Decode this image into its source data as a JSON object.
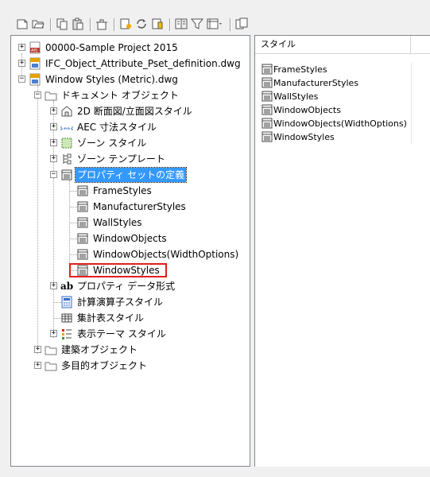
{
  "toolbar": {
    "buttons": [
      {
        "icon": "new-icon"
      },
      {
        "icon": "open-folder-icon"
      },
      {
        "icon": "copy-icon"
      },
      {
        "icon": "paste-icon"
      },
      {
        "icon": "purge-icon"
      },
      {
        "icon": "new-style-icon"
      },
      {
        "icon": "synchronize-icon"
      },
      {
        "icon": "edit-standards-icon"
      },
      {
        "icon": "toggle-view-icon"
      },
      {
        "icon": "filter-icon"
      },
      {
        "icon": "view-mode-icon"
      },
      {
        "icon": "inventory-icon"
      }
    ]
  },
  "tree": {
    "items": [
      {
        "label": "00000-Sample Project 2015",
        "icon": "project-icon",
        "expander": "+"
      },
      {
        "label": "IFC_Object_Attribute_Pset_definition.dwg",
        "icon": "drawing-icon",
        "expander": "+"
      },
      {
        "label": "Window Styles (Metric).dwg",
        "icon": "drawing-icon",
        "expander": "−"
      },
      {
        "label": "ドキュメント オブジェクト",
        "icon": "folder-icon",
        "expander": "−"
      },
      {
        "label": "2D 断面図/立面図スタイル",
        "icon": "section-elevation-icon",
        "expander": "+"
      },
      {
        "label": "AEC 寸法スタイル",
        "icon": "dimension-icon",
        "expander": "+"
      },
      {
        "label": "ゾーン スタイル",
        "icon": "zone-icon",
        "expander": "+"
      },
      {
        "label": "ゾーン テンプレート",
        "icon": "zone-template-icon",
        "expander": "+"
      },
      {
        "label": "プロパティ セットの定義",
        "icon": "property-set-icon",
        "expander": "−"
      },
      {
        "label": "FrameStyles",
        "icon": "property-set-icon"
      },
      {
        "label": "ManufacturerStyles",
        "icon": "property-set-icon"
      },
      {
        "label": "WallStyles",
        "icon": "property-set-icon"
      },
      {
        "label": "WindowObjects",
        "icon": "property-set-icon"
      },
      {
        "label": "WindowObjects(WidthOptions)",
        "icon": "property-set-icon"
      },
      {
        "label": "WindowStyles",
        "icon": "property-set-icon"
      },
      {
        "label": "プロパティ データ形式",
        "icon": "data-format-icon",
        "icon_text": "ab",
        "expander": "+"
      },
      {
        "label": "計算演算子スタイル",
        "icon": "calculation-icon"
      },
      {
        "label": "集計表スタイル",
        "icon": "schedule-table-icon"
      },
      {
        "label": "表示テーマ スタイル",
        "icon": "display-theme-icon",
        "expander": "+"
      },
      {
        "label": "建築オブジェクト",
        "icon": "folder-icon",
        "expander": "+"
      },
      {
        "label": "多目的オブジェクト",
        "icon": "folder-icon",
        "expander": "+"
      }
    ]
  },
  "list": {
    "column_header": "スタイル",
    "rows": [
      "FrameStyles",
      "ManufacturerStyles",
      "WallStyles",
      "WindowObjects",
      "WindowObjects(WidthOptions)",
      "WindowStyles"
    ]
  },
  "colors": {
    "selection": "#3399ff",
    "highlight_box": "#e0201a",
    "border": "#828790"
  }
}
